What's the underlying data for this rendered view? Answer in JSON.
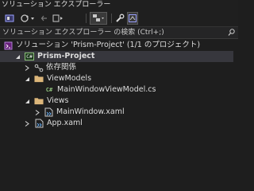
{
  "window": {
    "title": "ソリューション エクスプローラー"
  },
  "toolbar": {
    "buttons": [
      {
        "name": "home-button",
        "icon": "home-icon"
      },
      {
        "name": "sync-button",
        "icon": "sync-icon"
      },
      {
        "name": "back-button",
        "icon": "back-icon"
      },
      {
        "name": "pending-changes-button",
        "icon": "pending-changes-icon"
      },
      {
        "name": "show-all-files-button",
        "icon": "show-all-files-icon"
      },
      {
        "name": "properties-button",
        "icon": "wrench-icon"
      },
      {
        "name": "preview-button",
        "icon": "preview-icon"
      }
    ]
  },
  "search": {
    "placeholder": "ソリューション エクスプローラー の検索 (Ctrl+;)",
    "icon": "search-icon"
  },
  "tree": {
    "solution": {
      "label": "ソリューション 'Prism-Project' (1/1 のプロジェクト)"
    },
    "project": {
      "label": "Prism-Project"
    },
    "dependencies": {
      "label": "依存関係"
    },
    "viewmodels": {
      "label": "ViewModels"
    },
    "mainwindowviewmodel": {
      "label": "MainWindowViewModel.cs"
    },
    "views": {
      "label": "Views"
    },
    "mainwindow": {
      "label": "MainWindow.xaml"
    },
    "app": {
      "label": "App.xaml"
    }
  },
  "colors": {
    "background": "#1e1e1e",
    "selected_row": "#37373d",
    "folder": "#dcb67a",
    "csharp": "#8ec07c",
    "text": "#dcdcdc"
  }
}
